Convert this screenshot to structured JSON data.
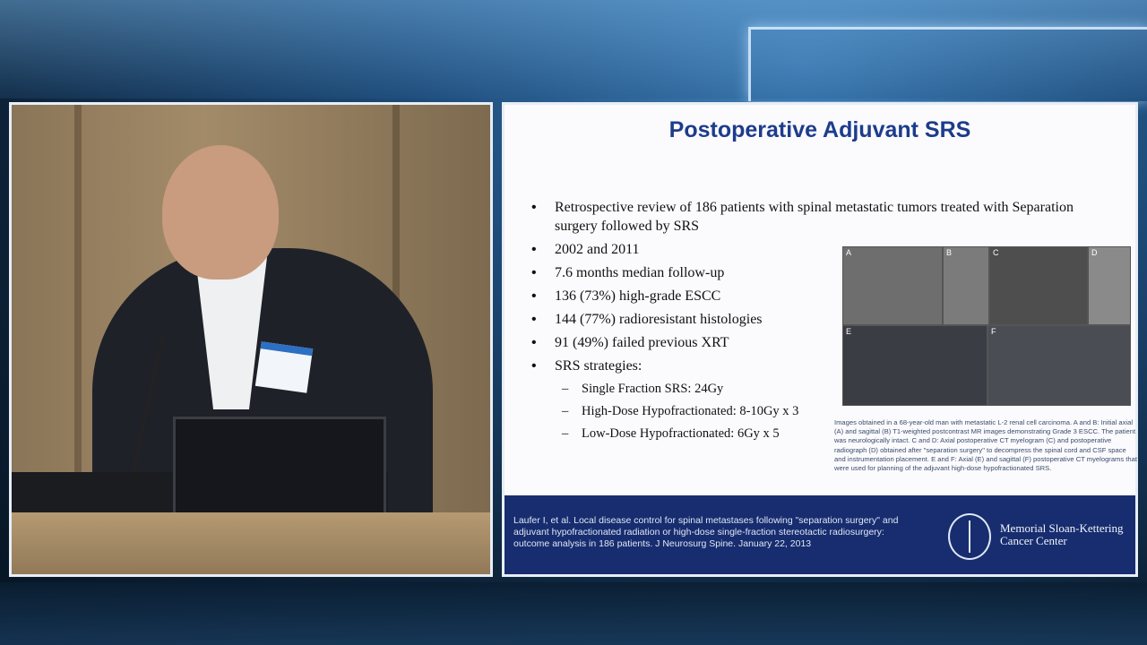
{
  "slide": {
    "title": "Postoperative Adjuvant SRS",
    "bullets": [
      "Retrospective review of 186 patients with spinal metastatic tumors treated with Separation surgery followed by SRS",
      "2002 and 2011",
      "7.6 months median follow-up",
      "136 (73%) high-grade ESCC",
      "144 (77%) radioresistant histologies",
      "91 (49%) failed previous XRT",
      "SRS strategies:"
    ],
    "sub_bullets": [
      "Single Fraction SRS: 24Gy",
      "High-Dose Hypofractionated: 8-10Gy x 3",
      "Low-Dose Hypofractionated: 6Gy x 5"
    ],
    "image_labels": [
      "A",
      "B",
      "C",
      "D",
      "E",
      "F"
    ],
    "caption": "Images obtained in a 68-year-old man with metastatic L-2 renal cell carcinoma. A and B: Initial axial (A) and sagittal (B) T1-weighted postcontrast MR images demonstrating Grade 3 ESCC. The patient was neurologically intact. C and D: Axial postoperative CT myelogram (C) and postoperative radiograph (D) obtained after \"separation surgery\" to decompress the spinal cord and CSF space and instrumentation placement. E and F: Axial (E) and sagittal (F) postoperative CT myelograms that were used for planning of the adjuvant high-dose hypofractionated SRS.",
    "citation": "Laufer I, et al. Local disease control for spinal metastases following \"separation surgery\" and adjuvant hypofractionated radiation or high-dose single-fraction stereotactic radiosurgery: outcome analysis in 186 patients. J Neurosurg Spine. January 22, 2013",
    "logo_text": "Memorial Sloan-Kettering Cancer Center"
  },
  "colors": {
    "title": "#1d3c8c",
    "footer": "#172d6f",
    "badge_stripe": "#2d6fc2"
  }
}
